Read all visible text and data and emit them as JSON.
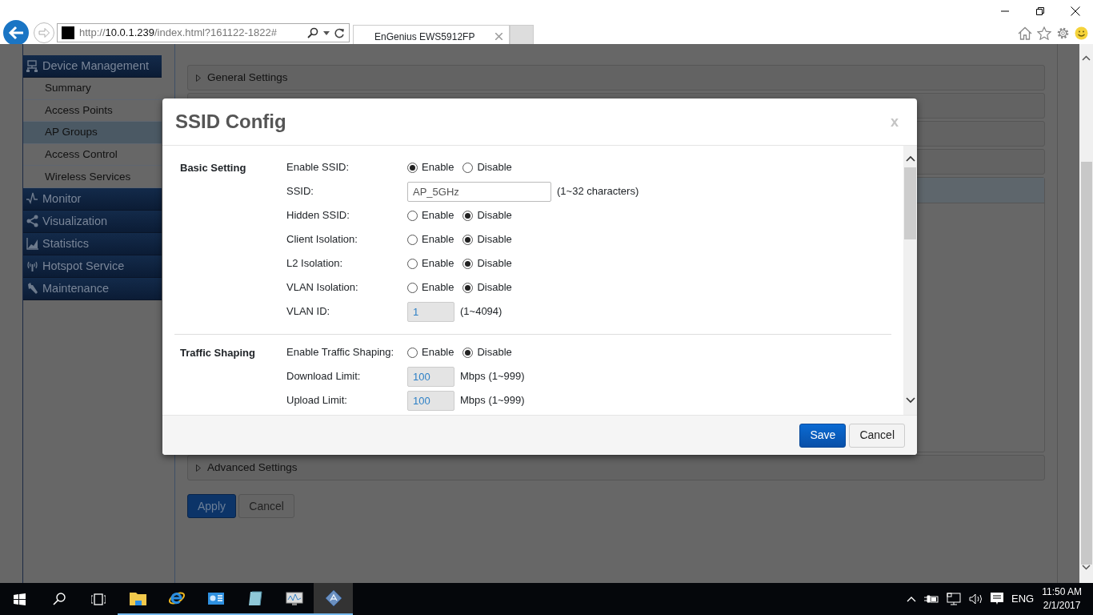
{
  "browser": {
    "address": {
      "scheme": "http://",
      "host": "10.0.1.239",
      "path": "/index.html?161122-1822#"
    },
    "tab_title": "EnGenius EWS5912FP"
  },
  "sidebar": {
    "groups": [
      {
        "label": "Device Management",
        "items": [
          {
            "label": "Summary",
            "selected": false
          },
          {
            "label": "Access Points",
            "selected": false
          },
          {
            "label": "AP Groups",
            "selected": true
          },
          {
            "label": "Access Control",
            "selected": false
          },
          {
            "label": "Wireless Services",
            "selected": false
          }
        ]
      },
      {
        "label": "Monitor"
      },
      {
        "label": "Visualization"
      },
      {
        "label": "Statistics"
      },
      {
        "label": "Hotspot Service"
      },
      {
        "label": "Maintenance"
      }
    ]
  },
  "page": {
    "top_section": "General Settings",
    "bottom_section": "Advanced Settings",
    "buttons": [
      {
        "label": "Apply",
        "kind": "primary"
      },
      {
        "label": "Cancel",
        "kind": "secondary"
      }
    ]
  },
  "modal": {
    "title": "SSID Config",
    "close": "x",
    "sections": [
      {
        "title": "Basic Setting",
        "rows": [
          {
            "kind": "radio",
            "label": "Enable SSID:",
            "options": [
              {
                "label": "Enable",
                "selected": true
              },
              {
                "label": "Disable",
                "selected": false
              }
            ]
          },
          {
            "kind": "text",
            "label": "SSID:",
            "value": "AP_5GHz",
            "hint": "(1~32 characters)",
            "disabled": false
          },
          {
            "kind": "radio",
            "label": "Hidden SSID:",
            "options": [
              {
                "label": "Enable",
                "selected": false
              },
              {
                "label": "Disable",
                "selected": true
              }
            ]
          },
          {
            "kind": "radio",
            "label": "Client Isolation:",
            "options": [
              {
                "label": "Enable",
                "selected": false
              },
              {
                "label": "Disable",
                "selected": true
              }
            ]
          },
          {
            "kind": "radio",
            "label": "L2 Isolation:",
            "options": [
              {
                "label": "Enable",
                "selected": false
              },
              {
                "label": "Disable",
                "selected": true
              }
            ]
          },
          {
            "kind": "radio",
            "label": "VLAN Isolation:",
            "options": [
              {
                "label": "Enable",
                "selected": false
              },
              {
                "label": "Disable",
                "selected": true
              }
            ]
          },
          {
            "kind": "number",
            "label": "VLAN ID:",
            "value": "1",
            "hint": "(1~4094)",
            "disabled": true
          }
        ]
      },
      {
        "title": "Traffic Shaping",
        "rows": [
          {
            "kind": "radio",
            "label": "Enable Traffic Shaping:",
            "options": [
              {
                "label": "Enable",
                "selected": false
              },
              {
                "label": "Disable",
                "selected": true
              }
            ]
          },
          {
            "kind": "number",
            "label": "Download Limit:",
            "value": "100",
            "hint": "Mbps (1~999)",
            "disabled": true
          },
          {
            "kind": "number",
            "label": "Upload Limit:",
            "value": "100",
            "hint": "Mbps (1~999)",
            "disabled": true
          }
        ]
      }
    ],
    "buttons": [
      {
        "label": "Save",
        "kind": "primary"
      },
      {
        "label": "Cancel",
        "kind": "secondary"
      }
    ]
  },
  "taskbar": {
    "language": "ENG",
    "time": "11:50 AM",
    "date": "2/1/2017"
  }
}
